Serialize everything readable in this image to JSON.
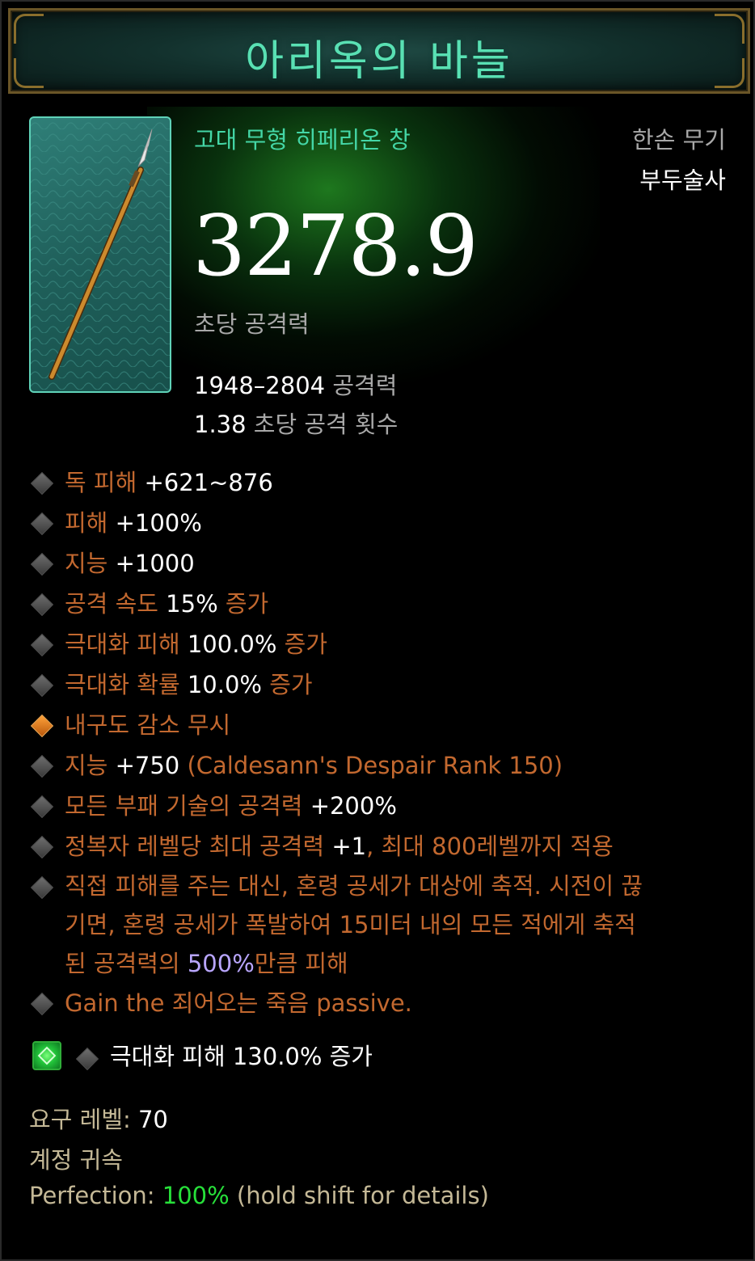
{
  "item": {
    "name": "아리옥의 바늘",
    "type": "고대 무형 히페리온 창",
    "slot": "한손 무기",
    "class": "부두술사",
    "dps": "3278.9",
    "dps_label": "초당 공격력",
    "damage_range": "1948–2804",
    "damage_label": "공격력",
    "attack_speed": "1.38",
    "attack_speed_label": "초당 공격 횟수"
  },
  "affixes": [
    {
      "label": "독 피해",
      "value": "+621~876",
      "suffix": ""
    },
    {
      "label": "피해",
      "value": "+100%",
      "suffix": ""
    },
    {
      "label": "지능",
      "value": "+1000",
      "suffix": ""
    },
    {
      "label": "공격 속도",
      "value": "15%",
      "suffix": "증가"
    },
    {
      "label": "극대화 피해",
      "value": "100.0%",
      "suffix": "증가"
    },
    {
      "label": "극대화 확률",
      "value": "10.0%",
      "suffix": "증가"
    },
    {
      "label": "내구도 감소 무시",
      "value": "",
      "suffix": ""
    },
    {
      "label": "지능",
      "value": "+750",
      "suffix": "(Caldesann's Despair Rank 150)"
    },
    {
      "label": "모든 부패 기술의 공격력",
      "value": "+200%",
      "suffix": ""
    },
    {
      "label": "정복자 레벨당 최대 공격력",
      "value": "+1",
      "suffix": ", 최대 800레벨까지 적용"
    },
    {
      "line1": "직접 피해를 주는 대신, 혼령 공세가 대상에 축적. 시전이 끊",
      "line2": "기면, 혼령 공세가 폭발하여 15미터 내의 모든 적에게 축적",
      "line3_a": "된 공격력의 ",
      "line3_b": "500%",
      "line3_c": "만큼 피해"
    },
    {
      "label": "Gain the 죄어오는 죽음 passive.",
      "value": "",
      "suffix": ""
    }
  ],
  "socket": {
    "gem_icon": "emerald-gem-icon",
    "text": "극대화 피해 130.0% 증가"
  },
  "footer": {
    "level_label": "요구 레벨:",
    "level_value": "70",
    "bound": "계정 귀속",
    "perfection_label": "Perfection:",
    "perfection_value": "100%",
    "perfection_hint": "(hold shift for details)"
  },
  "colors": {
    "title": "#59e0b3",
    "affix": "#c2682f",
    "legendary_bullet": "#ff9a2e",
    "footer": "#c4b896",
    "perfection": "#27e03a"
  }
}
